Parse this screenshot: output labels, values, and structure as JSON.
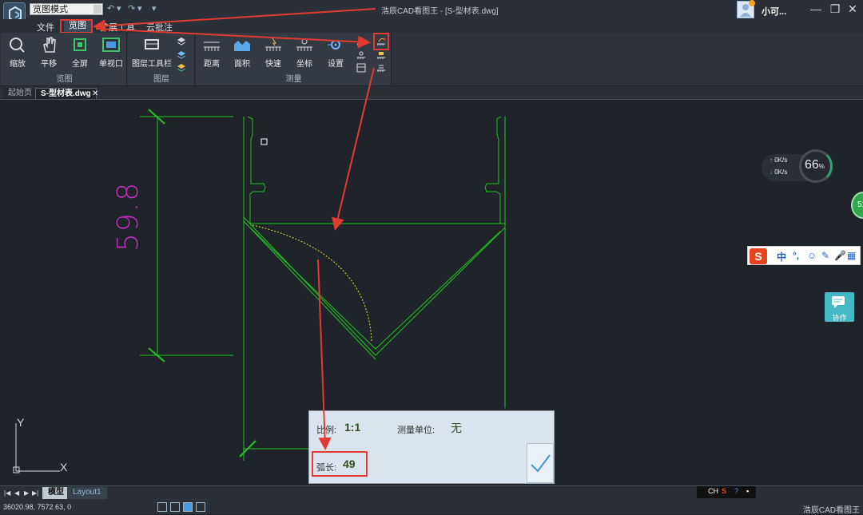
{
  "titlebar": {
    "mode": "览图模式",
    "app_title": "浩辰CAD看图王",
    "file_title": "- [S-型材表.dwg]",
    "user_name": "小可...",
    "min": "—",
    "restore": "❐",
    "close": "✕",
    "qa_undo": "↶",
    "qa_redo": "↷",
    "qa_more": "▾"
  },
  "menu": {
    "tabs": [
      "文件",
      "览图",
      "扩展工具",
      "云批注"
    ],
    "active": "览图"
  },
  "ribbon": {
    "view_group": {
      "label": "览图",
      "buttons": [
        "缩放",
        "平移",
        "全屏",
        "单视口"
      ]
    },
    "layer_group": {
      "label": "图层",
      "buttons": [
        "图层工具栏"
      ]
    },
    "measure_group": {
      "label": "测量",
      "buttons": [
        "距离",
        "面积",
        "快速",
        "坐标",
        "设置"
      ]
    }
  },
  "doc_tabs": {
    "start": "起始页",
    "current": "S-型材表.dwg",
    "close": "✕"
  },
  "drawing": {
    "dimension_text": "59.8"
  },
  "widgets": {
    "net_up": "0K/s",
    "net_down": "0K/s",
    "percent": "66",
    "percent_unit": "%",
    "green_badge": "51",
    "ime": [
      "中",
      "°,",
      "☺",
      "✎",
      "🎤",
      "▦"
    ],
    "collab_label": "协作"
  },
  "measure_panel": {
    "scale_label": "比例:",
    "scale_value": "1:1",
    "unit_label": "测量单位:",
    "unit_value": "无",
    "arc_label": "弧长:",
    "arc_value": "49"
  },
  "layout_tabs": {
    "model": "模型",
    "layout1": "Layout1"
  },
  "statusbar": {
    "coords": "36020.98, 7572.63, 0",
    "app_name": "浩辰CAD看图王",
    "tray_lang": "CH"
  },
  "colors": {
    "accent_red": "#e33b34",
    "drawing_green": "#22c522",
    "arc_yellow": "#e5e53a",
    "dim_magenta": "#c02ec0"
  }
}
